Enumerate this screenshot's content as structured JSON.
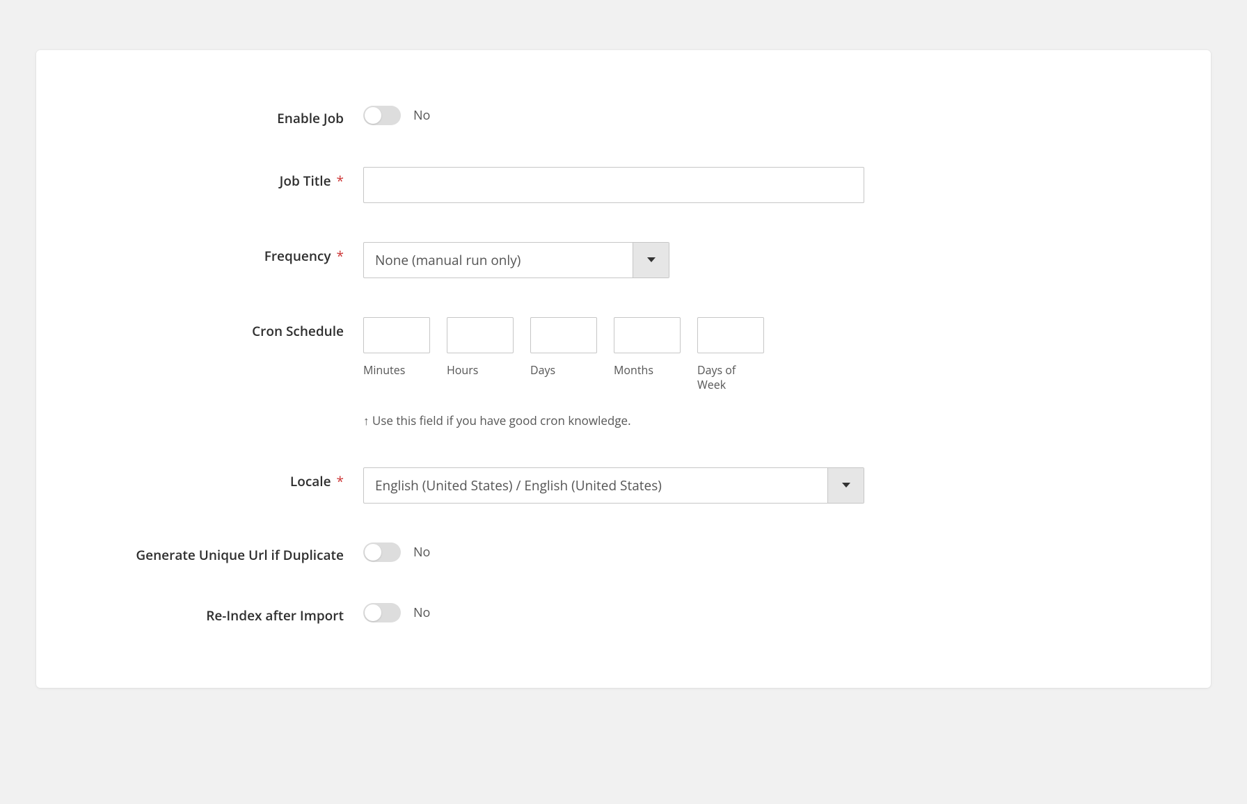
{
  "fields": {
    "enable_job": {
      "label": "Enable Job",
      "state_text": "No"
    },
    "job_title": {
      "label": "Job Title",
      "value": ""
    },
    "frequency": {
      "label": "Frequency",
      "selected": "None (manual run only)"
    },
    "cron": {
      "label": "Cron Schedule",
      "sub_minutes": "Minutes",
      "sub_hours": "Hours",
      "sub_days": "Days",
      "sub_months": "Months",
      "sub_dow": "Days of Week",
      "note": "↑ Use this field if you have good cron knowledge.",
      "val_minutes": "",
      "val_hours": "",
      "val_days": "",
      "val_months": "",
      "val_dow": ""
    },
    "locale": {
      "label": "Locale",
      "selected": "English (United States) / English (United States)"
    },
    "unique_url": {
      "label": "Generate Unique Url if Duplicate",
      "state_text": "No"
    },
    "reindex": {
      "label": "Re-Index after Import",
      "state_text": "No"
    }
  },
  "required_mark": "*"
}
